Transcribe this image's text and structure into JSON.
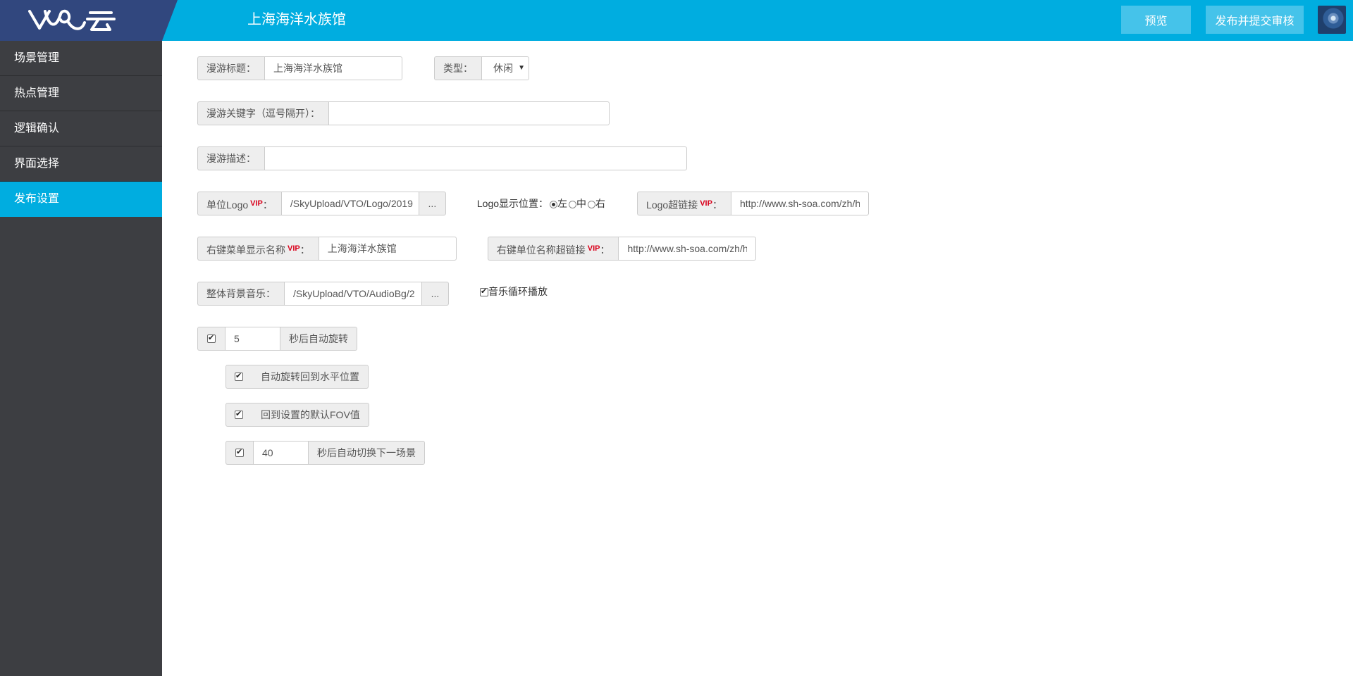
{
  "header": {
    "app_title": "上海海洋水族馆",
    "preview_label": "预览",
    "publish_label": "发布并提交审核"
  },
  "sidebar": {
    "items": [
      {
        "label": "场景管理",
        "active": false
      },
      {
        "label": "热点管理",
        "active": false
      },
      {
        "label": "逻辑确认",
        "active": false
      },
      {
        "label": "界面选择",
        "active": false
      },
      {
        "label": "发布设置",
        "active": true
      }
    ]
  },
  "form": {
    "title_label": "漫游标题：",
    "title_value": "上海海洋水族馆",
    "type_label": "类型：",
    "type_value": "休闲",
    "keywords_label": "漫游关键字（逗号隔开）：",
    "keywords_value": "",
    "desc_label": "漫游描述：",
    "desc_value": "",
    "logo_label": "单位Logo",
    "vip_tag": "VIP",
    "colon": "：",
    "logo_path": "/SkyUpload/VTO/Logo/2019",
    "browse_label": "...",
    "logo_pos_label": "Logo显示位置：",
    "logo_pos_options": [
      "左",
      "中",
      "右"
    ],
    "logo_pos_selected": "左",
    "logo_link_label": "Logo超链接",
    "logo_link_value": "http://www.sh-soa.com/zh/h",
    "menu_name_label": "右键菜单显示名称",
    "menu_name_value": "上海海洋水族馆",
    "unit_link_label": "右键单位名称超链接",
    "unit_link_value": "http://www.sh-soa.com/zh/h",
    "bgm_label": "整体背景音乐：",
    "bgm_path": "/SkyUpload/VTO/AudioBg/2",
    "loop_label": "音乐循环播放",
    "loop_checked": true,
    "auto_rotate_checked": true,
    "auto_rotate_seconds": "5",
    "auto_rotate_suffix": "秒后自动旋转",
    "return_horizontal_checked": true,
    "return_horizontal_label": "自动旋转回到水平位置",
    "return_fov_checked": true,
    "return_fov_label": "回到设置的默认FOV值",
    "auto_switch_checked": true,
    "auto_switch_seconds": "40",
    "auto_switch_suffix": "秒后自动切换下一场景"
  }
}
